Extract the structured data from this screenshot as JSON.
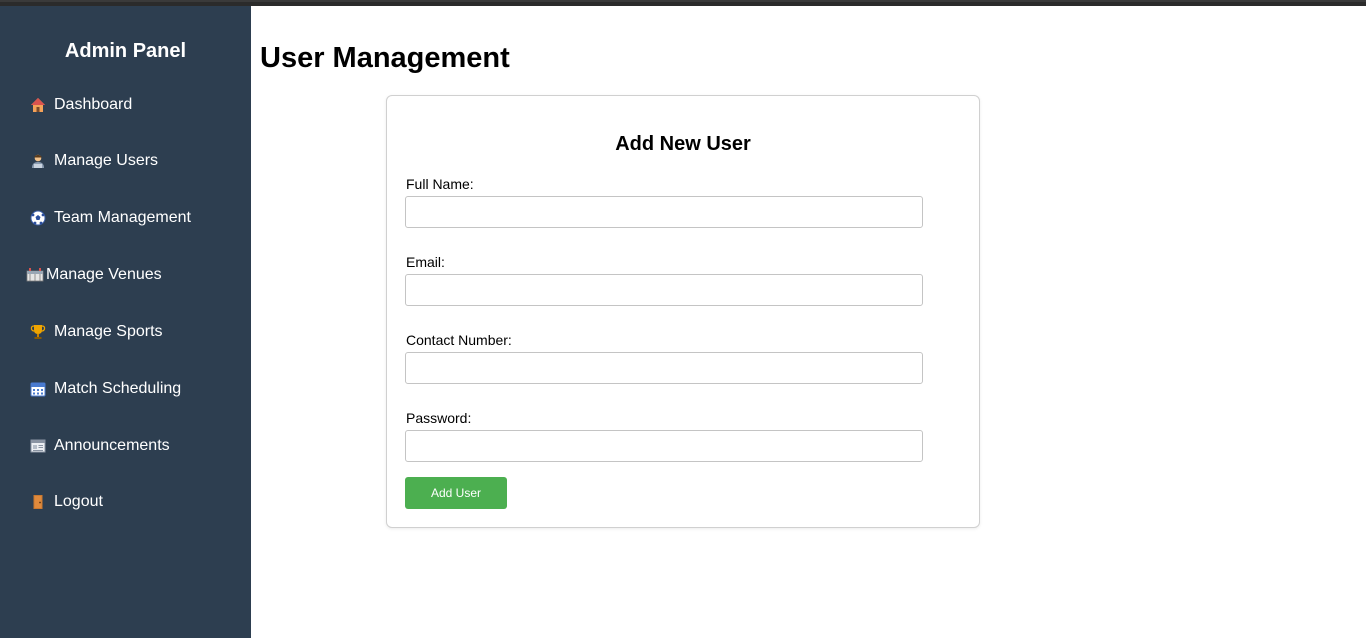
{
  "sidebar": {
    "title": "Admin Panel",
    "background": "#2d3e50",
    "items": [
      {
        "label": "Dashboard",
        "icon": "house-icon"
      },
      {
        "label": "Manage Users",
        "icon": "user-icon"
      },
      {
        "label": "Team Management",
        "icon": "soccer-ball-icon"
      },
      {
        "label": "Manage Venues",
        "icon": "stadium-icon"
      },
      {
        "label": "Manage Sports",
        "icon": "trophy-icon"
      },
      {
        "label": "Match Scheduling",
        "icon": "calendar-icon"
      },
      {
        "label": "Announcements",
        "icon": "newspaper-icon"
      },
      {
        "label": "Logout",
        "icon": "door-icon"
      }
    ]
  },
  "main": {
    "title": "User Management",
    "form": {
      "title": "Add New User",
      "fields": [
        {
          "label": "Full Name:",
          "value": "",
          "placeholder": ""
        },
        {
          "label": "Email:",
          "value": "",
          "placeholder": ""
        },
        {
          "label": "Contact Number:",
          "value": "",
          "placeholder": ""
        },
        {
          "label": "Password:",
          "value": "",
          "placeholder": ""
        }
      ],
      "submit_label": "Add User",
      "submit_color": "#4caf50"
    }
  }
}
